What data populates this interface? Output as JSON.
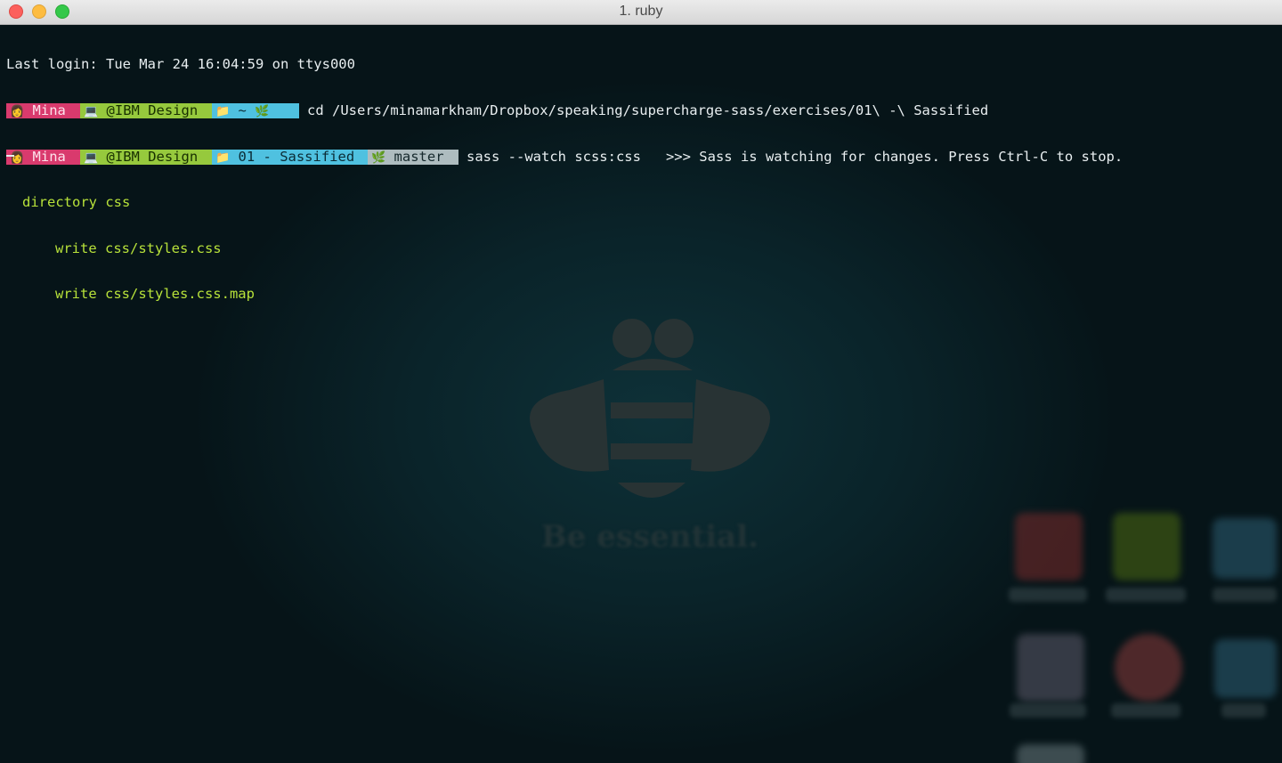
{
  "window": {
    "title": "1. ruby"
  },
  "terminal": {
    "last_login": "Last login: Tue Mar 24 16:04:59 on ttys000",
    "prompt1": {
      "user": "Mina",
      "host": "@IBM Design",
      "dir": "~",
      "command": "cd /Users/minamarkham/Dropbox/speaking/supercharge-sass/exercises/01\\ -\\ Sassified"
    },
    "prompt2": {
      "user": "Mina",
      "host": "@IBM Design",
      "dir": "01 - Sassified",
      "branch": "master",
      "command": "sass --watch scss:css   >>> Sass is watching for changes. Press Ctrl-C to stop."
    },
    "output": [
      "directory css",
      "write css/styles.css",
      "write css/styles.css.map"
    ]
  },
  "wallpaper": {
    "tagline": "Be essential."
  },
  "colors": {
    "user_bg": "#d93a6d",
    "host_bg": "#96c93d",
    "dir_bg": "#4fc1e0",
    "git_bg": "#aebcbf",
    "output": "#b8e23a"
  },
  "icons": [
    "woman-icon",
    "computer-icon",
    "folder-icon",
    "branch-icon"
  ]
}
